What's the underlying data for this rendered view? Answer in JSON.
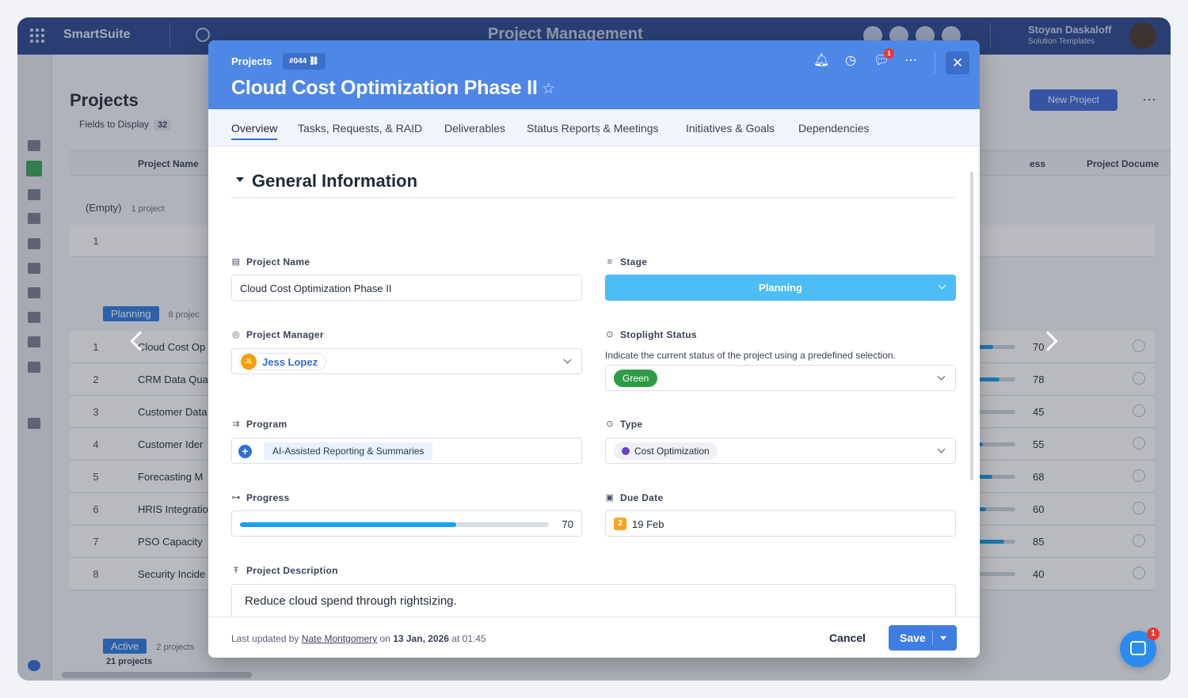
{
  "app": {
    "brand": "SmartSuite",
    "workspace_title": "Project Management",
    "user_name": "Stoyan Daskaloff",
    "user_role": "Solution Templates"
  },
  "background": {
    "page_title": "Projects",
    "fields_label": "Fields to Display",
    "fields_count": "32",
    "new_project": "New Project",
    "col_name": "Project Name",
    "col_progress_partial": "ess",
    "col_documents": "Project Docume",
    "groups": [
      {
        "label": "(Empty)",
        "count": "1 project"
      },
      {
        "label": "Planning",
        "count": "8 projec",
        "color": "#2e7de0"
      },
      {
        "label": "Active",
        "count": "2 projects",
        "color": "#2e7de0"
      }
    ],
    "empty_rows": [
      {
        "num": "1"
      }
    ],
    "rows": [
      {
        "num": "1",
        "name": "Cloud Cost Op",
        "progress": 70
      },
      {
        "num": "2",
        "name": "CRM Data Qua",
        "progress": 78
      },
      {
        "num": "3",
        "name": "Customer Data",
        "progress": 45
      },
      {
        "num": "4",
        "name": "Customer Ider",
        "progress": 55
      },
      {
        "num": "5",
        "name": "Forecasting M",
        "progress": 68
      },
      {
        "num": "6",
        "name": "HRIS Integratio",
        "progress": 60
      },
      {
        "num": "7",
        "name": "PSO Capacity",
        "progress": 85
      },
      {
        "num": "8",
        "name": "Security Incide",
        "progress": 40
      }
    ],
    "total": "21 projects"
  },
  "modal": {
    "breadcrumb": "Projects",
    "record_id": "#044",
    "title": "Cloud Cost Optimization Phase II",
    "notification_count": "1",
    "tabs": [
      "Overview",
      "Tasks, Requests, & RAID",
      "Deliverables",
      "Status Reports & Meetings",
      "Initiatives & Goals",
      "Dependencies"
    ],
    "section_title": "General Information",
    "fields": {
      "project_name": {
        "label": "Project Name",
        "value": "Cloud Cost Optimization Phase II"
      },
      "stage": {
        "label": "Stage",
        "value": "Planning",
        "color": "#4cbdf5"
      },
      "project_manager": {
        "label": "Project Manager",
        "initials": "JL",
        "value": "Jess Lopez"
      },
      "stoplight": {
        "label": "Stoplight Status",
        "hint": "Indicate the current status of the project using a predefined selection.",
        "value": "Green",
        "color": "#2e9b45"
      },
      "program": {
        "label": "Program",
        "value": "AI-Assisted Reporting & Summaries"
      },
      "type": {
        "label": "Type",
        "value": "Cost Optimization",
        "color": "#6b3fd1"
      },
      "progress": {
        "label": "Progress",
        "value": 70,
        "display": "70"
      },
      "due_date": {
        "label": "Due Date",
        "badge": "2",
        "value": "19 Feb"
      },
      "description": {
        "label": "Project Description",
        "value": "Reduce cloud spend through rightsizing."
      }
    },
    "footer": {
      "prefix": "Last updated",
      "by": "by",
      "user": "Nate Montgomery",
      "on": "on",
      "date": "13 Jan, 2026",
      "at": "at",
      "time": "01:45",
      "cancel": "Cancel",
      "save": "Save"
    }
  },
  "chat": {
    "badge": "1"
  }
}
